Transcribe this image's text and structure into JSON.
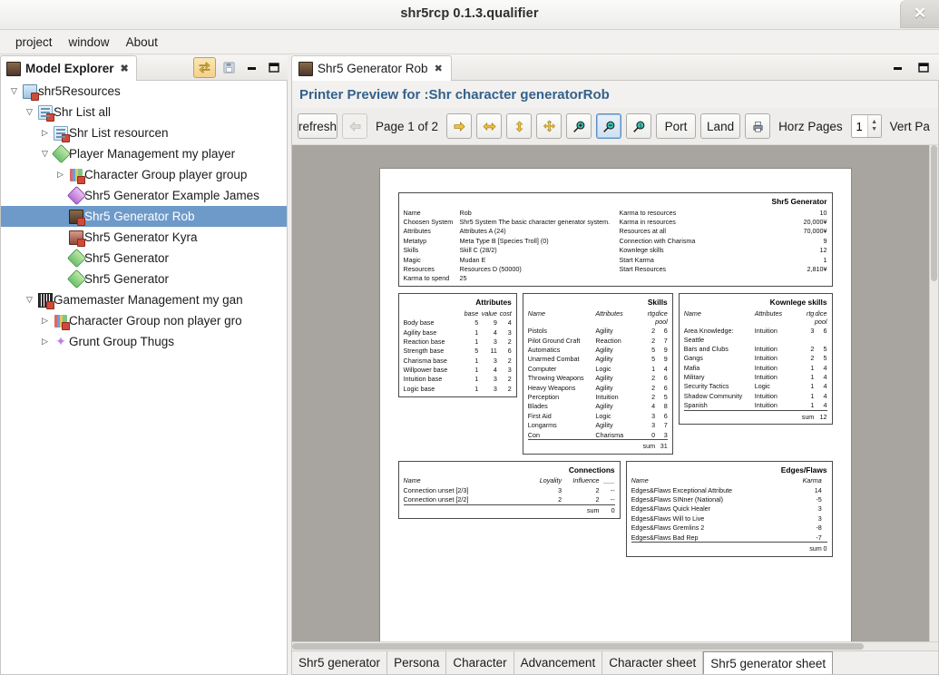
{
  "window": {
    "title": "shr5rcp 0.1.3.qualifier",
    "close_icon": "close-icon"
  },
  "menubar": {
    "items": [
      {
        "label": "project"
      },
      {
        "label": "window"
      },
      {
        "label": "About"
      }
    ]
  },
  "explorer": {
    "tab_label": "Model Explorer",
    "tab_close": "✖",
    "toolbar": [
      {
        "name": "link-with-editor-icon",
        "selected": true
      },
      {
        "name": "save-icon",
        "selected": false
      }
    ],
    "view_buttons": [
      {
        "name": "minimize-icon"
      },
      {
        "name": "maximize-icon"
      }
    ],
    "tree": [
      {
        "label": "shr5Resources",
        "depth": 0,
        "twisty": "down",
        "icon": "resource-icon",
        "selected": false
      },
      {
        "label": "Shr List all",
        "depth": 1,
        "twisty": "down",
        "icon": "list-icon",
        "selected": false
      },
      {
        "label": "Shr List resourcen",
        "depth": 2,
        "twisty": "right",
        "icon": "list-icon",
        "selected": false
      },
      {
        "label": "Player Management my player",
        "depth": 2,
        "twisty": "down",
        "icon": "diamond-green-icon",
        "selected": false
      },
      {
        "label": "Character Group player group",
        "depth": 3,
        "twisty": "right",
        "icon": "group-icon",
        "selected": false
      },
      {
        "label": "Shr5 Generator Example James",
        "depth": 3,
        "twisty": "none",
        "icon": "diamond-purple-icon",
        "selected": false
      },
      {
        "label": "Shr5 Generator Rob",
        "depth": 3,
        "twisty": "none",
        "icon": "portrait-rob-icon",
        "selected": true
      },
      {
        "label": "Shr5 Generator Kyra",
        "depth": 3,
        "twisty": "none",
        "icon": "portrait-kyra-icon",
        "selected": false
      },
      {
        "label": "Shr5 Generator",
        "depth": 3,
        "twisty": "none",
        "icon": "diamond-green-icon",
        "selected": false
      },
      {
        "label": "Shr5 Generator",
        "depth": 3,
        "twisty": "none",
        "icon": "diamond-green-icon",
        "selected": false
      },
      {
        "label": "Gamemaster Management my gan",
        "depth": 1,
        "twisty": "down",
        "icon": "gamemaster-icon",
        "selected": false
      },
      {
        "label": "Character Group non player gro",
        "depth": 2,
        "twisty": "right",
        "icon": "group-icon",
        "selected": false
      },
      {
        "label": "Grunt Group Thugs",
        "depth": 2,
        "twisty": "right",
        "icon": "star-purple-icon",
        "selected": false
      }
    ]
  },
  "editor": {
    "tab_label": "Shr5 Generator Rob",
    "tab_close": "✖",
    "view_buttons": [
      {
        "name": "minimize-icon"
      },
      {
        "name": "maximize-icon"
      }
    ],
    "preview_title": "Printer Preview for :Shr character generatorRob",
    "toolbar": {
      "refresh_label": "refresh",
      "back_icon": "arrow-left-icon",
      "page_label": "Page 1 of 2",
      "forward_icon": "arrow-right-icon",
      "fit_width_icon": "fit-width-icon",
      "fit_height_icon": "fit-height-icon",
      "fit_page_icon": "fit-page-icon",
      "zoom_in_icon": "zoom-in-icon",
      "zoom_out_icon": "zoom-out-icon",
      "zoom_100_icon": "zoom-100-icon",
      "portrait_label": "Port",
      "landscape_label": "Land",
      "print_icon": "print-icon",
      "horz_pages_label": "Horz Pages",
      "horz_pages_value": "1",
      "vert_pages_label": "Vert Pa"
    }
  },
  "bottom_tabs": [
    {
      "label": "Shr5 generator",
      "selected": false
    },
    {
      "label": "Persona",
      "selected": false
    },
    {
      "label": "Character",
      "selected": false
    },
    {
      "label": "Advancement",
      "selected": false
    },
    {
      "label": "Character sheet",
      "selected": false
    },
    {
      "label": "Shr5 generator sheet",
      "selected": true
    }
  ],
  "sheet": {
    "summary": {
      "title": "Shr5 Generator",
      "left_rows": [
        {
          "label": "Name",
          "value": "Rob"
        },
        {
          "label": "Choosen System",
          "value": "Shr5 System The basic character generator system."
        },
        {
          "label": "Attributes",
          "value": "Attributes A (24)"
        },
        {
          "label": "Metatyp",
          "value": "Meta Type B [Species Troll] (0)"
        },
        {
          "label": "Skills",
          "value": "Skill C (28/2)"
        },
        {
          "label": "Magic",
          "value": "Mudan E"
        },
        {
          "label": "Resources",
          "value": "Resources D (50000)"
        },
        {
          "label": "Karma to spend",
          "value": "25"
        }
      ],
      "right_rows": [
        {
          "label": "Karma to resources",
          "value": "10"
        },
        {
          "label": "Karma in resources",
          "value": "20,000¥"
        },
        {
          "label": "Resources at all",
          "value": "70,000¥"
        },
        {
          "label": "Connection with Charisma",
          "value": "9"
        },
        {
          "label": "Kownlege skills",
          "value": "12"
        },
        {
          "label": "Start Karma",
          "value": "1"
        },
        {
          "label": "Start Resources",
          "value": "2,810¥"
        }
      ]
    },
    "attributes": {
      "title": "Attributes",
      "columns": [
        "",
        "base",
        "value",
        "cost"
      ],
      "rows": [
        [
          "Body base",
          "5",
          "9",
          "4"
        ],
        [
          "Agility base",
          "1",
          "4",
          "3"
        ],
        [
          "Reaction base",
          "1",
          "3",
          "2"
        ],
        [
          "Strength base",
          "5",
          "11",
          "6"
        ],
        [
          "Charisma base",
          "1",
          "3",
          "2"
        ],
        [
          "Willpower base",
          "1",
          "4",
          "3"
        ],
        [
          "Intuition base",
          "1",
          "3",
          "2"
        ],
        [
          "Logic base",
          "1",
          "3",
          "2"
        ]
      ]
    },
    "skills": {
      "title": "Skills",
      "columns": [
        "Name",
        "Attributes",
        "rtg",
        "dice pool"
      ],
      "rows": [
        [
          "Pistols",
          "Agility",
          "2",
          "6"
        ],
        [
          "Pilot Ground Craft",
          "Reaction",
          "2",
          "7"
        ],
        [
          "Automatics",
          "Agility",
          "5",
          "9"
        ],
        [
          "Unarmed Combat",
          "Agility",
          "5",
          "9"
        ],
        [
          "Computer",
          "Logic",
          "1",
          "4"
        ],
        [
          "Throwing Weapons",
          "Agility",
          "2",
          "6"
        ],
        [
          "Heavy Weapons",
          "Agility",
          "2",
          "6"
        ],
        [
          "Perception",
          "Intuition",
          "2",
          "5"
        ],
        [
          "Blades",
          "Agility",
          "4",
          "8"
        ],
        [
          "First Aid",
          "Logic",
          "3",
          "6"
        ],
        [
          "Longarms",
          "Agility",
          "3",
          "7"
        ],
        [
          "Con",
          "Charisma",
          "0",
          "3"
        ]
      ],
      "sum_label": "sum",
      "sum_value": "31"
    },
    "knowledge": {
      "title": "Kownlege skills",
      "columns": [
        "Name",
        "Attributes",
        "rtg",
        "dice pool"
      ],
      "rows": [
        [
          "Area Knowledge: Seattle",
          "Intuition",
          "3",
          "6"
        ],
        [
          "Bars and Clubs",
          "Intuition",
          "2",
          "5"
        ],
        [
          "Gangs",
          "Intuition",
          "2",
          "5"
        ],
        [
          "Mafia",
          "Intuition",
          "1",
          "4"
        ],
        [
          "Military",
          "Intuition",
          "1",
          "4"
        ],
        [
          "Security Tactics",
          "Logic",
          "1",
          "4"
        ],
        [
          "Shadow Community",
          "Intuition",
          "1",
          "4"
        ],
        [
          "Spanish",
          "Intuition",
          "1",
          "4"
        ]
      ],
      "sum_label": "sum",
      "sum_value": "12"
    },
    "connections": {
      "title": "Connections",
      "columns": [
        "Name",
        "Loyality",
        "Influence",
        "___"
      ],
      "rows": [
        [
          "Connection  unset [2/3]",
          "3",
          "2",
          "--"
        ],
        [
          "Connection  unset [2/2]",
          "2",
          "2",
          "--"
        ]
      ],
      "sum_label": "sum",
      "sum_value": "0"
    },
    "edges": {
      "title": "Edges/Flaws",
      "columns": [
        "Name",
        "Karma"
      ],
      "rows": [
        [
          "Edges&Flaws Exceptional Attribute",
          "14"
        ],
        [
          "Edges&Flaws SINner (National)",
          "-5"
        ],
        [
          "Edges&Flaws Quick Healer",
          "3"
        ],
        [
          "Edges&Flaws Will to Live",
          "3"
        ],
        [
          "Edges&Flaws Gremlins 2",
          "-8"
        ],
        [
          "Edges&Flaws Bad Rep",
          "-7"
        ]
      ],
      "sum_label": "sum",
      "sum_value": "0"
    }
  }
}
